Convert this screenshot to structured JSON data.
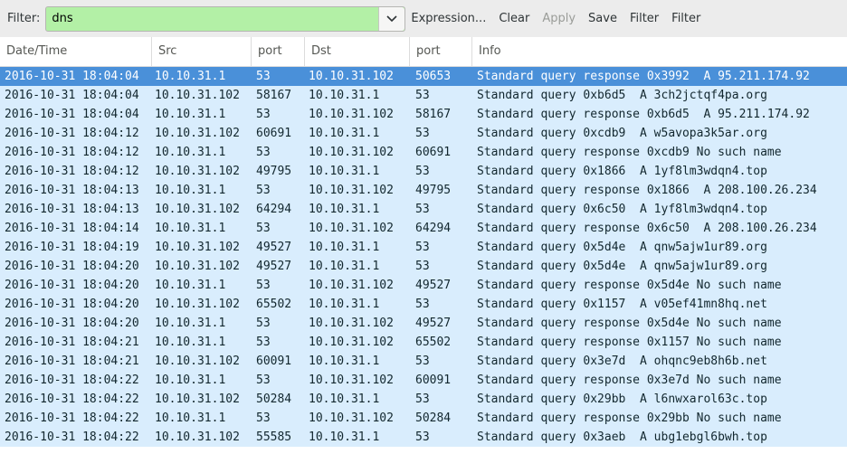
{
  "toolbar": {
    "filter_label": "Filter:",
    "filter_value": "dns",
    "buttons": [
      {
        "label": "Expression...",
        "enabled": true
      },
      {
        "label": "Clear",
        "enabled": true
      },
      {
        "label": "Apply",
        "enabled": false
      },
      {
        "label": "Save",
        "enabled": true
      },
      {
        "label": "Filter",
        "enabled": true
      },
      {
        "label": "Filter",
        "enabled": true
      }
    ]
  },
  "columns": [
    "Date/Time",
    "Src",
    "port",
    "Dst",
    "port",
    "Info"
  ],
  "rows": [
    [
      "2016-10-31 18:04:04",
      "10.10.31.1",
      "53",
      "10.10.31.102",
      "50653",
      "Standard query response 0x3992  A 95.211.174.92"
    ],
    [
      "2016-10-31 18:04:04",
      "10.10.31.102",
      "58167",
      "10.10.31.1",
      "53",
      "Standard query 0xb6d5  A 3ch2jctqf4pa.org"
    ],
    [
      "2016-10-31 18:04:04",
      "10.10.31.1",
      "53",
      "10.10.31.102",
      "58167",
      "Standard query response 0xb6d5  A 95.211.174.92"
    ],
    [
      "2016-10-31 18:04:12",
      "10.10.31.102",
      "60691",
      "10.10.31.1",
      "53",
      "Standard query 0xcdb9  A w5avopa3k5ar.org"
    ],
    [
      "2016-10-31 18:04:12",
      "10.10.31.1",
      "53",
      "10.10.31.102",
      "60691",
      "Standard query response 0xcdb9 No such name"
    ],
    [
      "2016-10-31 18:04:12",
      "10.10.31.102",
      "49795",
      "10.10.31.1",
      "53",
      "Standard query 0x1866  A 1yf8lm3wdqn4.top"
    ],
    [
      "2016-10-31 18:04:13",
      "10.10.31.1",
      "53",
      "10.10.31.102",
      "49795",
      "Standard query response 0x1866  A 208.100.26.234"
    ],
    [
      "2016-10-31 18:04:13",
      "10.10.31.102",
      "64294",
      "10.10.31.1",
      "53",
      "Standard query 0x6c50  A 1yf8lm3wdqn4.top"
    ],
    [
      "2016-10-31 18:04:14",
      "10.10.31.1",
      "53",
      "10.10.31.102",
      "64294",
      "Standard query response 0x6c50  A 208.100.26.234"
    ],
    [
      "2016-10-31 18:04:19",
      "10.10.31.102",
      "49527",
      "10.10.31.1",
      "53",
      "Standard query 0x5d4e  A qnw5ajw1ur89.org"
    ],
    [
      "2016-10-31 18:04:20",
      "10.10.31.102",
      "49527",
      "10.10.31.1",
      "53",
      "Standard query 0x5d4e  A qnw5ajw1ur89.org"
    ],
    [
      "2016-10-31 18:04:20",
      "10.10.31.1",
      "53",
      "10.10.31.102",
      "49527",
      "Standard query response 0x5d4e No such name"
    ],
    [
      "2016-10-31 18:04:20",
      "10.10.31.102",
      "65502",
      "10.10.31.1",
      "53",
      "Standard query 0x1157  A v05ef41mn8hq.net"
    ],
    [
      "2016-10-31 18:04:20",
      "10.10.31.1",
      "53",
      "10.10.31.102",
      "49527",
      "Standard query response 0x5d4e No such name"
    ],
    [
      "2016-10-31 18:04:21",
      "10.10.31.1",
      "53",
      "10.10.31.102",
      "65502",
      "Standard query response 0x1157 No such name"
    ],
    [
      "2016-10-31 18:04:21",
      "10.10.31.102",
      "60091",
      "10.10.31.1",
      "53",
      "Standard query 0x3e7d  A ohqnc9eb8h6b.net"
    ],
    [
      "2016-10-31 18:04:22",
      "10.10.31.1",
      "53",
      "10.10.31.102",
      "60091",
      "Standard query response 0x3e7d No such name"
    ],
    [
      "2016-10-31 18:04:22",
      "10.10.31.102",
      "50284",
      "10.10.31.1",
      "53",
      "Standard query 0x29bb  A l6nwxarol63c.top"
    ],
    [
      "2016-10-31 18:04:22",
      "10.10.31.1",
      "53",
      "10.10.31.102",
      "50284",
      "Standard query response 0x29bb No such name"
    ],
    [
      "2016-10-31 18:04:22",
      "10.10.31.102",
      "55585",
      "10.10.31.1",
      "53",
      "Standard query 0x3aeb  A ubg1ebgl6bwh.top"
    ]
  ],
  "selected_row": 0,
  "colors": {
    "filter_valid": "#b3f0a6",
    "row_background": "#d9edfd",
    "selection": "#4a90d9"
  },
  "icons": {
    "filter_dropdown": "chevron-down-icon"
  }
}
